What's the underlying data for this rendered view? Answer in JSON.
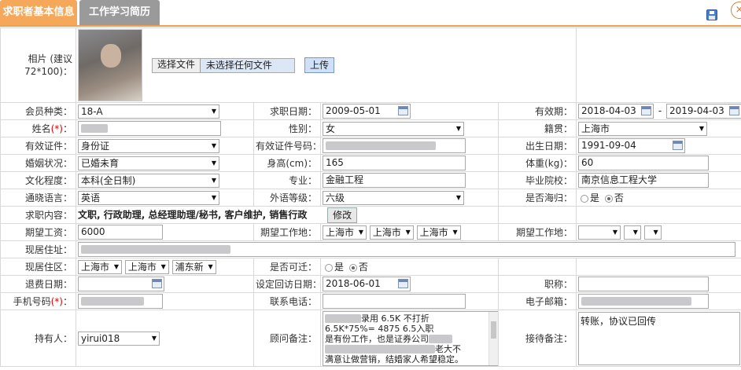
{
  "tabs": [
    {
      "label": "求职者基本信息"
    },
    {
      "label": "工作学习简历"
    }
  ],
  "photo": {
    "label": "相片 (建议72*100)：",
    "file_button": "选择文件",
    "file_status": "未选择任何文件",
    "upload_button": "上传"
  },
  "member": {
    "label": "会员种类：",
    "value": "18-A"
  },
  "apply_date": {
    "label": "求职日期：",
    "value": "2009-05-01"
  },
  "validity": {
    "label": "有效期：",
    "from": "2018-04-03",
    "sep": "-",
    "to": "2019-04-03"
  },
  "name": {
    "label": "姓名",
    "req": "(*)",
    "colon": "："
  },
  "gender": {
    "label": "性别：",
    "value": "女"
  },
  "native": {
    "label": "籍贯：",
    "value": "上海市"
  },
  "id_type": {
    "label": "有效证件：",
    "value": "身份证"
  },
  "id_no": {
    "label": "有效证件号码："
  },
  "birth": {
    "label": "出生日期：",
    "value": "1991-09-04"
  },
  "marriage": {
    "label": "婚姻状况：",
    "value": "已婚未育"
  },
  "height": {
    "label": "身高(cm)：",
    "value": "165"
  },
  "weight": {
    "label": "体重(kg)：",
    "value": "60"
  },
  "education": {
    "label": "文化程度：",
    "value": "本科(全日制)"
  },
  "major": {
    "label": "专业：",
    "value": "金融工程"
  },
  "school": {
    "label": "毕业院校：",
    "value": "南京信息工程大学"
  },
  "language": {
    "label": "通晓语言：",
    "value": "英语"
  },
  "foreign_level": {
    "label": "外语等级：",
    "value": "六级"
  },
  "overseas": {
    "label": "是否海归：",
    "yes": "是",
    "no": "否",
    "selected": "no"
  },
  "job_content": {
    "label": "求职内容：",
    "value": "文职, 行政助理, 总经理助理/秘书, 客户维护, 销售行政",
    "edit_button": "修改"
  },
  "salary": {
    "label": "期望工资：",
    "value": "6000"
  },
  "work_location": {
    "label": "期望工作地：",
    "a": "上海市",
    "b": "上海市",
    "c": "上海市"
  },
  "work_location2": {
    "label": "期望工作地："
  },
  "address": {
    "label": "现居住址："
  },
  "current_area": {
    "label": "现居住区：",
    "a": "上海市",
    "b": "上海市",
    "c": "浦东新"
  },
  "relocate": {
    "label": "是否可迁：",
    "yes": "是",
    "no": "否",
    "selected": "no"
  },
  "refund_date": {
    "label": "退费日期："
  },
  "visit_date": {
    "label": "设定回访日期：",
    "value": "2018-06-01"
  },
  "title": {
    "label": "职称："
  },
  "mobile": {
    "label": "手机号码",
    "req": "(*)",
    "colon": "："
  },
  "phone": {
    "label": "联系电话："
  },
  "email": {
    "label": "电子邮箱："
  },
  "holder": {
    "label": "持有人：",
    "value": "yirui018"
  },
  "consultant_note": {
    "label": "顾问备注：",
    "lines": [
      "录用 6.5K  不打折",
      "6.5K*75%= 4875   6.5入职",
      "是有份工作，也是证券公司",
      "老大不",
      "满意让做营销，结婚家人希望稳定。"
    ]
  },
  "reception_note": {
    "label": "接待备注：",
    "value": "转账，协议已回传"
  }
}
